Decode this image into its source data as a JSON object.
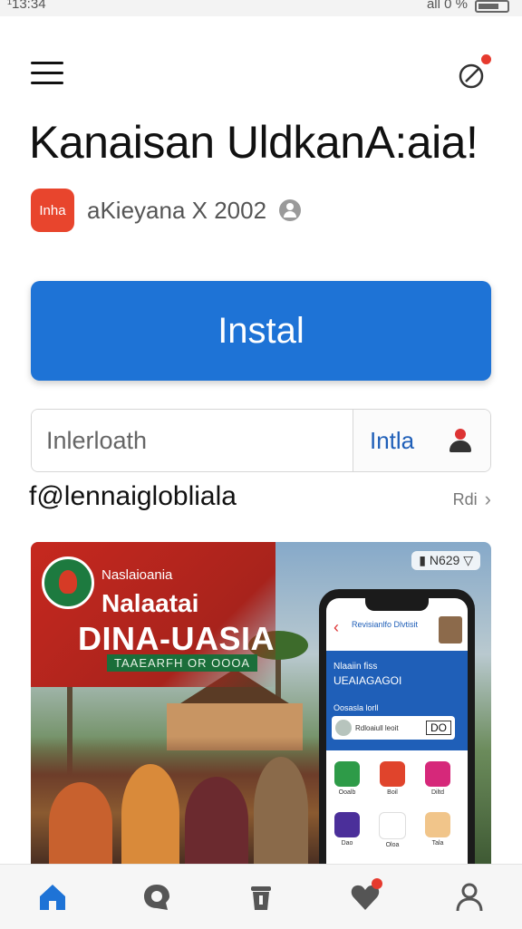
{
  "status_bar": {
    "time": "¹13:34",
    "battery_text": "all 0 %"
  },
  "header": {
    "title": "Kanaisan UldkanA:aia!"
  },
  "app": {
    "icon_text": "Inha",
    "developer": "aKieyana X 2002"
  },
  "install": {
    "label": "Instal"
  },
  "search": {
    "placeholder": "Inlerloath",
    "action_label": "Intla"
  },
  "section": {
    "title": "f@lennaiglobliala",
    "more_label": "Rdi"
  },
  "banner": {
    "subtitle": "Naslaioania",
    "name": "Nalaatai",
    "headline": "DINA-UASIA",
    "strip_text": "TAAEARFH OR OOOA",
    "badge": "N629",
    "phone": {
      "brand": "Revisianlfo Dlvtisit",
      "line1": "Nlaaiin fiss",
      "line2": "UEAIAGAGOI",
      "line3": "Oosasla lorll",
      "row_text": "Rdloaiull leoit",
      "row_badge": "DO",
      "apps": [
        "Ooalb",
        "Boil",
        "Diltd",
        "Dao",
        "Oloa",
        "Tala"
      ]
    }
  },
  "nav": {
    "items": [
      "home-icon",
      "chat-icon",
      "trash-icon",
      "heart-icon",
      "profile-icon"
    ]
  },
  "colors": {
    "accent": "#1e73d6",
    "notification": "#e63a2e",
    "app_icon": "#e8452d"
  }
}
